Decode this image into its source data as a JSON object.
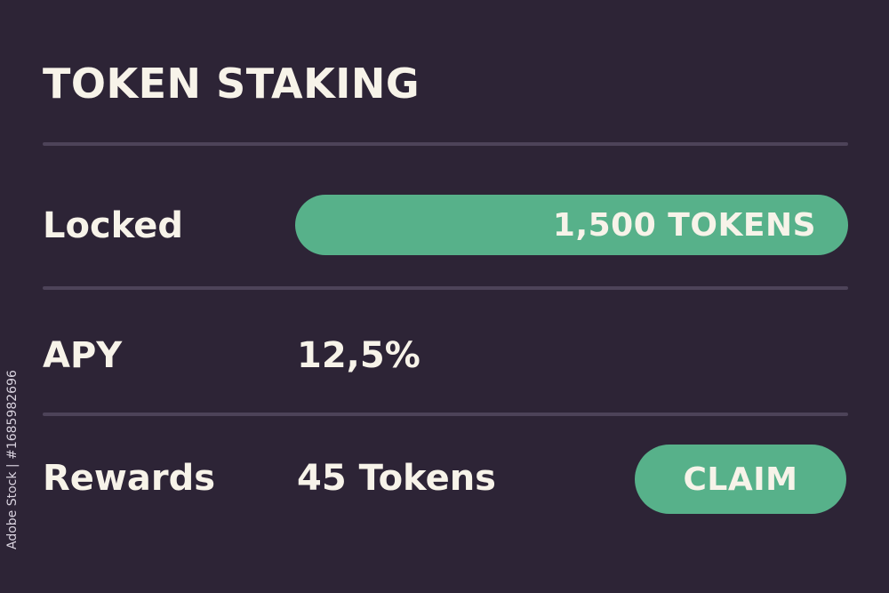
{
  "header": {
    "title": "TOKEN STAKING"
  },
  "rows": {
    "locked": {
      "label": "Locked",
      "value": "1,500 TOKENS"
    },
    "apy": {
      "label": "APY",
      "value": "12,5%"
    },
    "rewards": {
      "label": "Rewards",
      "value": "45 Tokens",
      "action_label": "CLAIM"
    }
  },
  "watermark": {
    "stock_id": "Adobe Stock | #1685982696"
  },
  "colors": {
    "background": "#2d2436",
    "accent": "#57b18a",
    "divider": "#4d4359",
    "text": "#f7f3e9"
  }
}
